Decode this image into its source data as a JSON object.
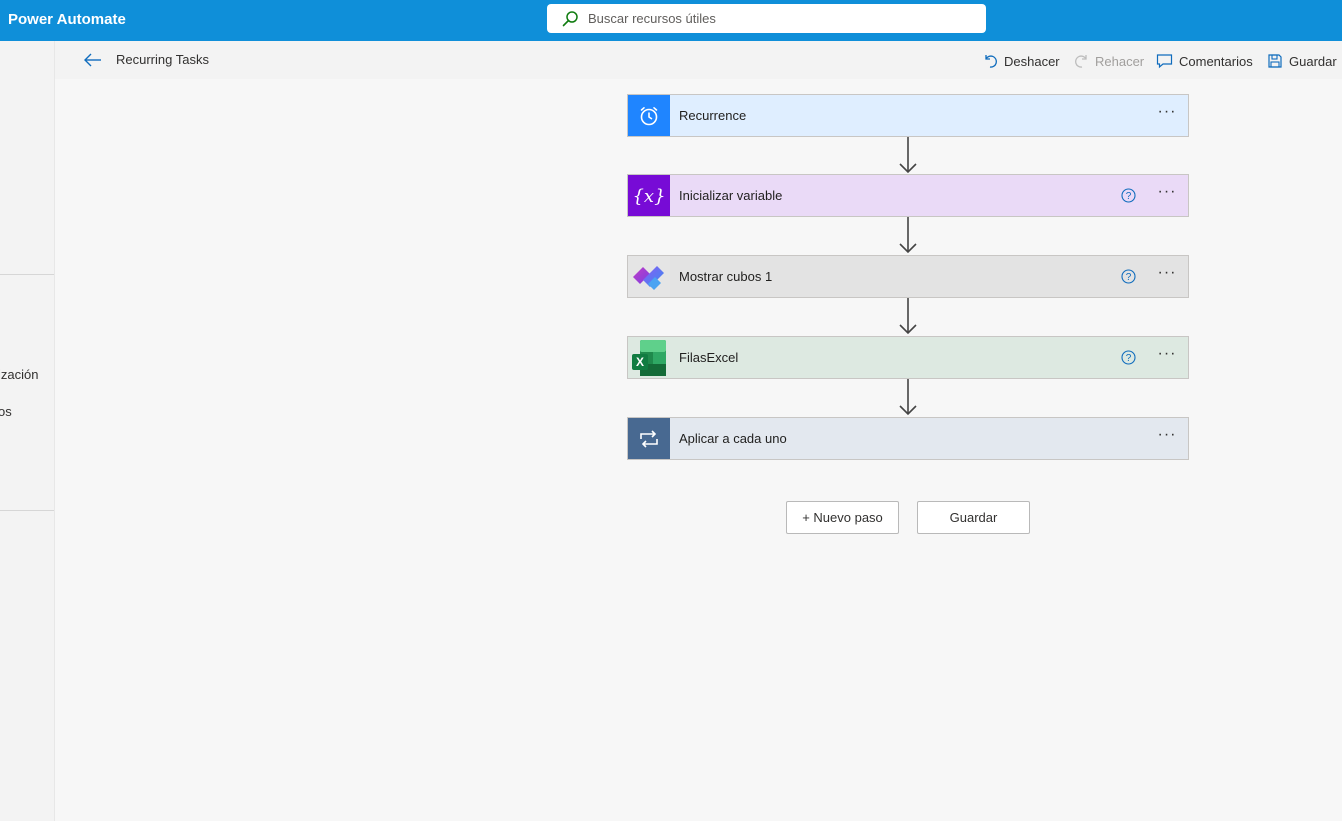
{
  "app": {
    "title": "Power Automate"
  },
  "search": {
    "placeholder": "Buscar recursos útiles"
  },
  "leftnav": {
    "partial_items": [
      "ización",
      "os"
    ]
  },
  "commandbar": {
    "flow_name": "Recurring Tasks",
    "undo": "Deshacer",
    "redo": "Rehacer",
    "comments": "Comentarios",
    "save": "Guardar"
  },
  "steps": [
    {
      "title": "Recurrence",
      "icon": "clock-icon",
      "color": "#1f85ff",
      "bg": "#dfeeff",
      "help": false
    },
    {
      "title": "Inicializar variable",
      "icon": "variable-icon",
      "color": "#770bd6",
      "bg": "#eadaf7",
      "help": true
    },
    {
      "title": "Mostrar cubos 1",
      "icon": "planner-icon",
      "color": "#e5e5e5",
      "bg": "#e3e3e3",
      "help": true
    },
    {
      "title": "FilasExcel",
      "icon": "excel-icon",
      "color": "#dde9e1",
      "bg": "#dde9e1",
      "help": true
    },
    {
      "title": "Aplicar a cada uno",
      "icon": "loop-icon",
      "color": "#486991",
      "bg": "#e3e8ef",
      "help": false
    }
  ],
  "actions": {
    "new_step": "+ Nuevo paso",
    "save": "Guardar"
  },
  "more_label": "···"
}
